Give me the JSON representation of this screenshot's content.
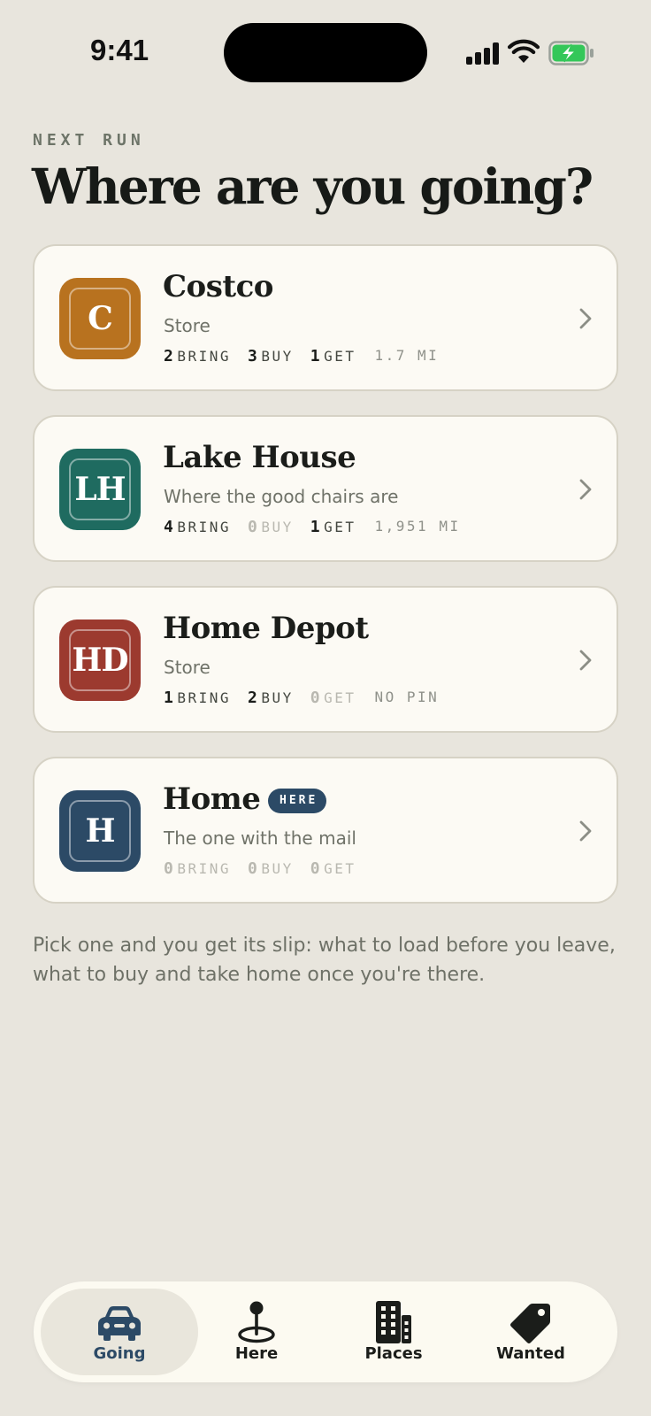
{
  "status_bar": {
    "time": "9:41"
  },
  "header": {
    "eyebrow": "NEXT RUN",
    "title": "Where are you going?"
  },
  "places": [
    {
      "initials": "C",
      "name": "Costco",
      "subtitle": "Store",
      "color": "#b8721f",
      "bring": "2",
      "bring_label": "BRING",
      "buy": "3",
      "buy_label": "BUY",
      "get": "1",
      "get_label": "GET",
      "distance": "1.7 MI"
    },
    {
      "initials": "LH",
      "name": "Lake House",
      "subtitle": "Where the good chairs are",
      "color": "#1f6b60",
      "bring": "4",
      "bring_label": "BRING",
      "buy": "0",
      "buy_label": "BUY",
      "get": "1",
      "get_label": "GET",
      "distance": "1,951 MI"
    },
    {
      "initials": "HD",
      "name": "Home Depot",
      "subtitle": "Store",
      "color": "#9c3a2f",
      "bring": "1",
      "bring_label": "BRING",
      "buy": "2",
      "buy_label": "BUY",
      "get": "0",
      "get_label": "GET",
      "distance": "NO PIN"
    },
    {
      "initials": "H",
      "name": "Home",
      "badge": "HERE",
      "subtitle": "The one with the mail",
      "color": "#2c4a66",
      "bring": "0",
      "bring_label": "BRING",
      "buy": "0",
      "buy_label": "BUY",
      "get": "0",
      "get_label": "GET"
    }
  ],
  "hint": "Pick one and you get its slip: what to load before you leave, what to buy and take home once you're there.",
  "tabs": [
    {
      "label": "Going",
      "icon": "car-icon",
      "active": true
    },
    {
      "label": "Here",
      "icon": "map-pin-icon",
      "active": false
    },
    {
      "label": "Places",
      "icon": "building-icon",
      "active": false
    },
    {
      "label": "Wanted",
      "icon": "tag-icon",
      "active": false
    }
  ],
  "colors": {
    "background": "#e8e5dd",
    "card": "#fcfaf4",
    "accent": "#2c4a66",
    "battery": "#34c759"
  }
}
